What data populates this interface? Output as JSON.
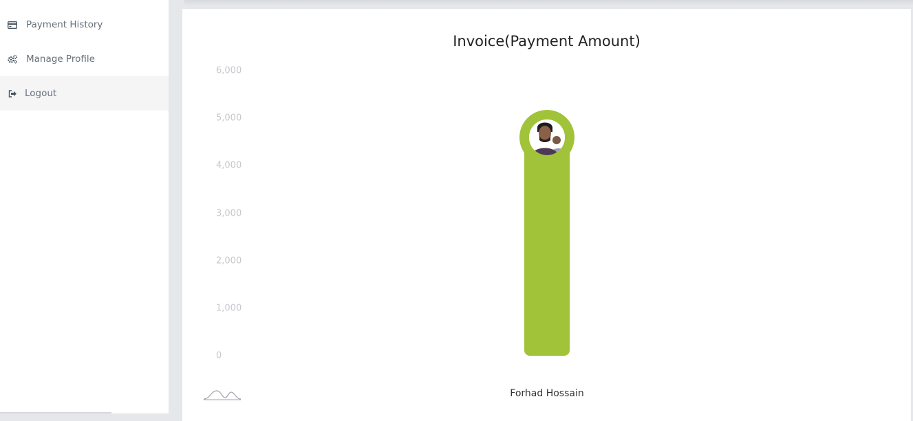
{
  "sidebar": {
    "items": [
      {
        "label": "Payment History",
        "icon": "credit-card-icon",
        "active": false
      },
      {
        "label": "Manage Profile",
        "icon": "gears-icon",
        "active": false
      },
      {
        "label": "Logout",
        "icon": "sign-out-icon",
        "active": true
      }
    ]
  },
  "chart_data": {
    "type": "bar",
    "title": "Invoice(Payment Amount)",
    "categories": [
      "Forhad Hossain"
    ],
    "values": [
      4600
    ],
    "ylim": [
      0,
      6000
    ],
    "yticks": [
      "6,000",
      "5,000",
      "4,000",
      "3,000",
      "2,000",
      "1,000",
      "0"
    ],
    "xlabel": "",
    "ylabel": "",
    "grid": false,
    "bar_color": "#a1c33a",
    "bar_marker": "avatar-photo"
  }
}
